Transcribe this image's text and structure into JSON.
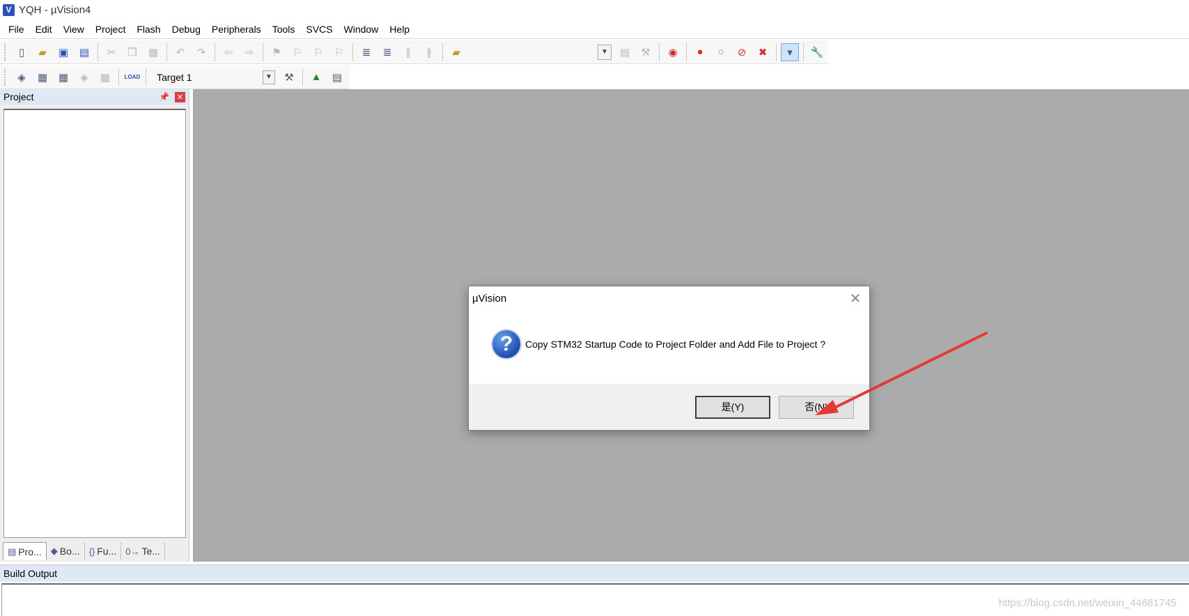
{
  "window": {
    "title": "YQH  - µVision4",
    "app_icon": "uvision-icon"
  },
  "menu": [
    "File",
    "Edit",
    "View",
    "Project",
    "Flash",
    "Debug",
    "Peripherals",
    "Tools",
    "SVCS",
    "Window",
    "Help"
  ],
  "toolbar2": {
    "target": "Target 1",
    "load_label": "LOAD"
  },
  "project_panel": {
    "title": "Project",
    "tabs": [
      {
        "label": "Pro...",
        "icon": "project-tab-icon"
      },
      {
        "label": "Bo...",
        "icon": "books-tab-icon"
      },
      {
        "label": "Fu...",
        "icon": "functions-tab-icon"
      },
      {
        "label": "Te...",
        "icon": "templates-tab-icon"
      }
    ]
  },
  "build_output": {
    "title": "Build Output"
  },
  "dialog": {
    "title": "µVision",
    "message": "Copy STM32 Startup Code to Project Folder and Add File to Project ?",
    "yes_label": "是(Y)",
    "no_label": "否(N)"
  },
  "watermark": "https://blog.csdn.net/weixin_44681745",
  "colors": {
    "workspace": "#ababab",
    "annotation_arrow": "#e53935",
    "panel_header": "#dfe9f5"
  }
}
